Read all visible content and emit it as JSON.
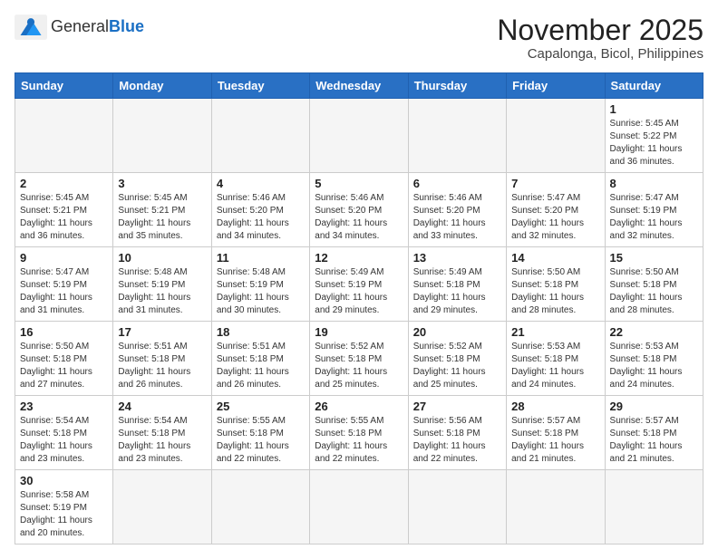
{
  "header": {
    "logo_general": "General",
    "logo_blue": "Blue",
    "month_title": "November 2025",
    "location": "Capalonga, Bicol, Philippines"
  },
  "weekdays": [
    "Sunday",
    "Monday",
    "Tuesday",
    "Wednesday",
    "Thursday",
    "Friday",
    "Saturday"
  ],
  "weeks": [
    [
      {
        "day": "",
        "empty": true
      },
      {
        "day": "",
        "empty": true
      },
      {
        "day": "",
        "empty": true
      },
      {
        "day": "",
        "empty": true
      },
      {
        "day": "",
        "empty": true
      },
      {
        "day": "",
        "empty": true
      },
      {
        "day": "1",
        "sunrise": "5:45 AM",
        "sunset": "5:22 PM",
        "daylight": "11 hours and 36 minutes."
      }
    ],
    [
      {
        "day": "2",
        "sunrise": "5:45 AM",
        "sunset": "5:21 PM",
        "daylight": "11 hours and 36 minutes."
      },
      {
        "day": "3",
        "sunrise": "5:45 AM",
        "sunset": "5:21 PM",
        "daylight": "11 hours and 35 minutes."
      },
      {
        "day": "4",
        "sunrise": "5:46 AM",
        "sunset": "5:20 PM",
        "daylight": "11 hours and 34 minutes."
      },
      {
        "day": "5",
        "sunrise": "5:46 AM",
        "sunset": "5:20 PM",
        "daylight": "11 hours and 34 minutes."
      },
      {
        "day": "6",
        "sunrise": "5:46 AM",
        "sunset": "5:20 PM",
        "daylight": "11 hours and 33 minutes."
      },
      {
        "day": "7",
        "sunrise": "5:47 AM",
        "sunset": "5:20 PM",
        "daylight": "11 hours and 32 minutes."
      },
      {
        "day": "8",
        "sunrise": "5:47 AM",
        "sunset": "5:19 PM",
        "daylight": "11 hours and 32 minutes."
      }
    ],
    [
      {
        "day": "9",
        "sunrise": "5:47 AM",
        "sunset": "5:19 PM",
        "daylight": "11 hours and 31 minutes."
      },
      {
        "day": "10",
        "sunrise": "5:48 AM",
        "sunset": "5:19 PM",
        "daylight": "11 hours and 31 minutes."
      },
      {
        "day": "11",
        "sunrise": "5:48 AM",
        "sunset": "5:19 PM",
        "daylight": "11 hours and 30 minutes."
      },
      {
        "day": "12",
        "sunrise": "5:49 AM",
        "sunset": "5:19 PM",
        "daylight": "11 hours and 29 minutes."
      },
      {
        "day": "13",
        "sunrise": "5:49 AM",
        "sunset": "5:18 PM",
        "daylight": "11 hours and 29 minutes."
      },
      {
        "day": "14",
        "sunrise": "5:50 AM",
        "sunset": "5:18 PM",
        "daylight": "11 hours and 28 minutes."
      },
      {
        "day": "15",
        "sunrise": "5:50 AM",
        "sunset": "5:18 PM",
        "daylight": "11 hours and 28 minutes."
      }
    ],
    [
      {
        "day": "16",
        "sunrise": "5:50 AM",
        "sunset": "5:18 PM",
        "daylight": "11 hours and 27 minutes."
      },
      {
        "day": "17",
        "sunrise": "5:51 AM",
        "sunset": "5:18 PM",
        "daylight": "11 hours and 26 minutes."
      },
      {
        "day": "18",
        "sunrise": "5:51 AM",
        "sunset": "5:18 PM",
        "daylight": "11 hours and 26 minutes."
      },
      {
        "day": "19",
        "sunrise": "5:52 AM",
        "sunset": "5:18 PM",
        "daylight": "11 hours and 25 minutes."
      },
      {
        "day": "20",
        "sunrise": "5:52 AM",
        "sunset": "5:18 PM",
        "daylight": "11 hours and 25 minutes."
      },
      {
        "day": "21",
        "sunrise": "5:53 AM",
        "sunset": "5:18 PM",
        "daylight": "11 hours and 24 minutes."
      },
      {
        "day": "22",
        "sunrise": "5:53 AM",
        "sunset": "5:18 PM",
        "daylight": "11 hours and 24 minutes."
      }
    ],
    [
      {
        "day": "23",
        "sunrise": "5:54 AM",
        "sunset": "5:18 PM",
        "daylight": "11 hours and 23 minutes."
      },
      {
        "day": "24",
        "sunrise": "5:54 AM",
        "sunset": "5:18 PM",
        "daylight": "11 hours and 23 minutes."
      },
      {
        "day": "25",
        "sunrise": "5:55 AM",
        "sunset": "5:18 PM",
        "daylight": "11 hours and 22 minutes."
      },
      {
        "day": "26",
        "sunrise": "5:55 AM",
        "sunset": "5:18 PM",
        "daylight": "11 hours and 22 minutes."
      },
      {
        "day": "27",
        "sunrise": "5:56 AM",
        "sunset": "5:18 PM",
        "daylight": "11 hours and 22 minutes."
      },
      {
        "day": "28",
        "sunrise": "5:57 AM",
        "sunset": "5:18 PM",
        "daylight": "11 hours and 21 minutes."
      },
      {
        "day": "29",
        "sunrise": "5:57 AM",
        "sunset": "5:18 PM",
        "daylight": "11 hours and 21 minutes."
      }
    ],
    [
      {
        "day": "30",
        "sunrise": "5:58 AM",
        "sunset": "5:19 PM",
        "daylight": "11 hours and 20 minutes."
      },
      {
        "day": "",
        "empty": true
      },
      {
        "day": "",
        "empty": true
      },
      {
        "day": "",
        "empty": true
      },
      {
        "day": "",
        "empty": true
      },
      {
        "day": "",
        "empty": true
      },
      {
        "day": "",
        "empty": true
      }
    ]
  ]
}
